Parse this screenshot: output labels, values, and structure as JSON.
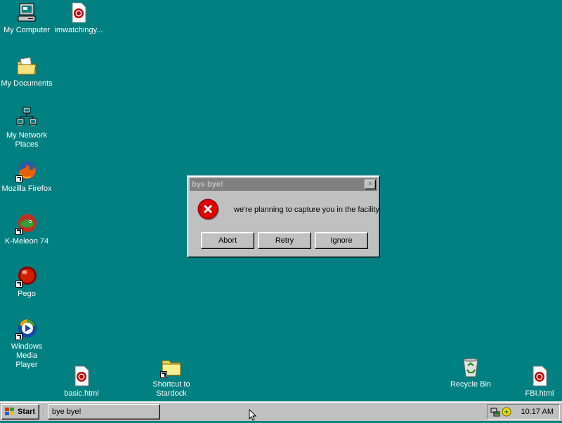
{
  "desktop": {
    "icons": [
      {
        "label": "My Computer",
        "icon": "my-computer-icon"
      },
      {
        "label": "imwatchingy...",
        "icon": "html-document-icon"
      },
      {
        "label": "My Documents",
        "icon": "my-documents-folder-icon"
      },
      {
        "label": "My Network Places",
        "icon": "network-places-icon"
      },
      {
        "label": "Mozilla Firefox",
        "icon": "firefox-icon"
      },
      {
        "label": "K-Meleon 74",
        "icon": "k-meleon-icon"
      },
      {
        "label": "Pego",
        "icon": "pego-icon"
      },
      {
        "label": "Windows Media Player",
        "icon": "media-player-icon"
      },
      {
        "label": "basic.html",
        "icon": "html-document-icon"
      },
      {
        "label": "Shortcut to Stardock",
        "icon": "folder-icon"
      },
      {
        "label": "Recycle Bin",
        "icon": "recycle-bin-icon"
      },
      {
        "label": "FBI.html",
        "icon": "html-document-icon"
      }
    ]
  },
  "dialog": {
    "title": "bye bye!",
    "close": "×",
    "message": "we're planning to capture you in the facility",
    "buttons": {
      "abort": "Abort",
      "retry": "Retry",
      "ignore": "Ignore"
    }
  },
  "taskbar": {
    "start_label": "Start",
    "task_label": "bye bye!",
    "clock": "10:17 AM"
  },
  "colors": {
    "desktop": "#008080",
    "title_inactive": "#808080",
    "face": "#c0c0c0"
  }
}
